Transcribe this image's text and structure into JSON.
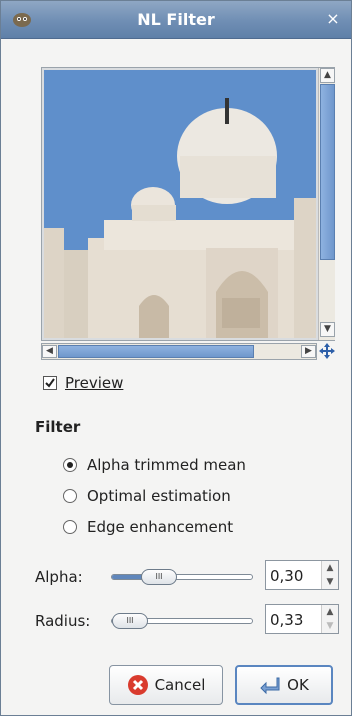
{
  "window": {
    "title": "NL Filter",
    "app_icon": "gimp-icon",
    "close_icon": "close-icon"
  },
  "preview": {
    "checkbox_label": "Preview",
    "checked": true,
    "image_description_icon": "preview-image",
    "navigate_icon": "navigate-icon"
  },
  "filter": {
    "section_title": "Filter",
    "options": [
      {
        "label": "Alpha trimmed mean",
        "selected": true
      },
      {
        "label": "Optimal estimation",
        "selected": false
      },
      {
        "label": "Edge enhancement",
        "selected": false
      }
    ]
  },
  "params": {
    "alpha": {
      "label": "Alpha:",
      "value": "0,30",
      "fraction": 0.3
    },
    "radius": {
      "label": "Radius:",
      "value": "0,33",
      "fraction": 0.0
    }
  },
  "buttons": {
    "cancel": {
      "label": "Cancel",
      "icon": "cancel-icon"
    },
    "ok": {
      "label": "OK",
      "icon": "ok-icon"
    }
  },
  "colors": {
    "accent": "#5f86bb",
    "titlebar": "#6f8eb4"
  }
}
